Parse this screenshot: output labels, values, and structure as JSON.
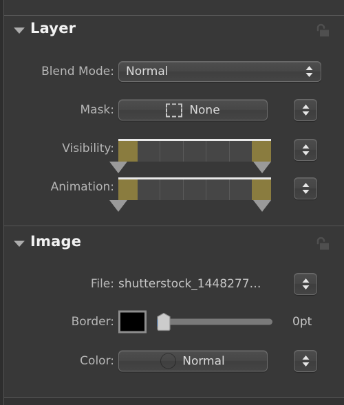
{
  "panel": {
    "accent_olive": "#8a7c3f",
    "background": "#383838"
  },
  "sections": [
    {
      "id": "layer",
      "title": "Layer",
      "disclosure_icon": "triangle-down-icon",
      "lock_icon": "unlocked-padlock-icon",
      "rows": [
        {
          "id": "blend-mode",
          "label": "Blend Mode:",
          "control": "popup-button",
          "value": "Normal",
          "has_stepper": false
        },
        {
          "id": "mask",
          "label": "Mask:",
          "control": "popup-button",
          "icon": "dashed-square-icon",
          "value": "None",
          "has_stepper": true
        },
        {
          "id": "visibility",
          "label": "Visibility:",
          "control": "range-timeline",
          "cells": 5,
          "start_fill_pct": 13,
          "end_fill_pct": 13,
          "has_stepper": true
        },
        {
          "id": "animation",
          "label": "Animation:",
          "control": "range-timeline",
          "cells": 5,
          "start_fill_pct": 13,
          "end_fill_pct": 13,
          "has_stepper": true
        }
      ]
    },
    {
      "id": "image",
      "title": "Image",
      "disclosure_icon": "triangle-down-icon",
      "lock_icon": "unlocked-padlock-icon",
      "rows": [
        {
          "id": "file",
          "label": "File:",
          "control": "text-value",
          "value": "shutterstock_1448277…",
          "has_stepper": true
        },
        {
          "id": "border",
          "label": "Border:",
          "control": "color-swatch-slider",
          "swatch_color": "#000000",
          "slider_value": 0,
          "unit_label": "0pt",
          "has_stepper": false
        },
        {
          "id": "color",
          "label": "Color:",
          "control": "popup-button",
          "icon": "color-wheel-icon",
          "value": "Normal",
          "has_stepper": true
        }
      ]
    }
  ]
}
